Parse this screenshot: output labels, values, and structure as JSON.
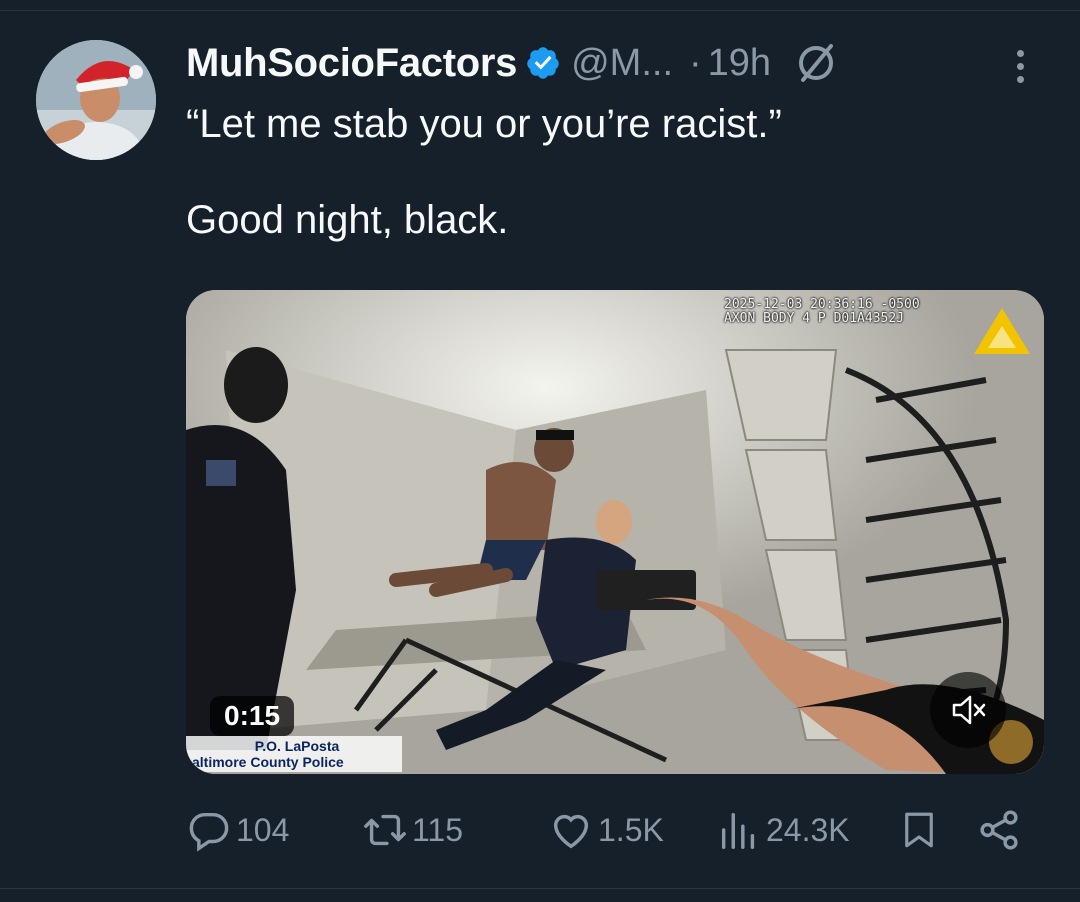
{
  "tweet": {
    "author": {
      "display_name": "MuhSocioFactors",
      "handle": "@M...",
      "separator": "·",
      "time": "19h"
    },
    "text": "“Let me stab you or you’re racist.”\n\nGood night, black.",
    "media": {
      "bodycam_line1": "2025-12-03 20:36:16 -0500",
      "bodycam_line2": "AXON BODY 4 P D01A4352J",
      "caption_name": "P.O. LaPosta",
      "caption_dept": "altimore County Police",
      "duration": "0:15",
      "mute_state": "muted"
    },
    "stats": {
      "replies": "104",
      "reposts": "115",
      "likes": "1.5K",
      "views": "24.3K"
    }
  },
  "colors": {
    "background": "#15202b",
    "text": "#f7f9f9",
    "muted": "#8b98a5",
    "verified": "#1d9bf0",
    "divider": "#2f3336"
  }
}
